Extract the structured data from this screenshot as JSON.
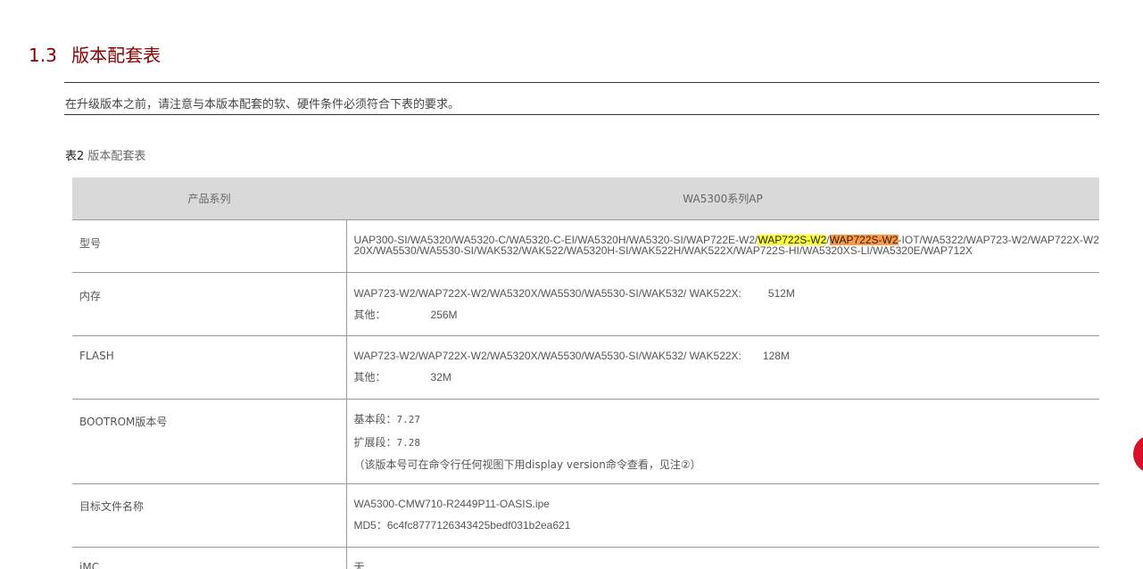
{
  "section": {
    "number": "1.3",
    "title": "版本配套表"
  },
  "intro": "在升级版本之前，请注意与本版本配套的软、硬件条件必须符合下表的要求。",
  "caption": {
    "label": "表2",
    "title": "版本配套表"
  },
  "table": {
    "headers": [
      "产品系列",
      "WA5300系列AP"
    ],
    "model": {
      "label": "型号",
      "line1_pre": "UAP300-SI/WA5320/WA5320-C/WA5320-C-EI/WA5320H/WA5320-SI/WAP722E-W2/",
      "line1_hl1": "WAP722S-W2",
      "line1_sep": "/",
      "line1_hl2": "WAP722S-W2",
      "line1_post": "-IOT/WA5322/WAP723-W2/WAP722X-W2",
      "line2": "20X/WA5530/WA5530-SI/WAK532/WAK522/WA5320H-SI/WAK522H/WAK522X/WAP722S-HI/WA5320XS-LI/WA5320E/WAP712X"
    },
    "memory": {
      "label": "内存",
      "line1_models": "WAP723-W2/WAP722X-W2/WA5320X/WA5530/WA5530-SI/WAK532/ WAK522X:",
      "line1_value": "512M",
      "line2_label": "其他：",
      "line2_value": "256M"
    },
    "flash": {
      "label": "FLASH",
      "line1_models": "WAP723-W2/WAP722X-W2/WA5320X/WA5530/WA5530-SI/WAK532/ WAK522X:",
      "line1_value": "128M",
      "line2_label": "其他：",
      "line2_value": "32M"
    },
    "bootrom": {
      "label": "BOOTROM版本号",
      "basic_label": "基本段：",
      "basic_value": "7.27",
      "ext_label": "扩展段：",
      "ext_value": "7.28",
      "note": "（该版本号可在命令行任何视图下用display version命令查看，见注②）"
    },
    "target_file": {
      "label": "目标文件名称",
      "filename": "WA5300-CMW710-R2449P11-OASIS.ipe",
      "md5": "MD5：6c4fc8777126343425bedf031b2ea621"
    },
    "imc": {
      "label": "iMC",
      "value": "无"
    }
  },
  "colors": {
    "title": "#8b0000",
    "header_bg": "#d9d9d9",
    "highlight_yellow": "#ffff33",
    "highlight_orange": "#ff9944",
    "floating_button": "#d8102a"
  }
}
